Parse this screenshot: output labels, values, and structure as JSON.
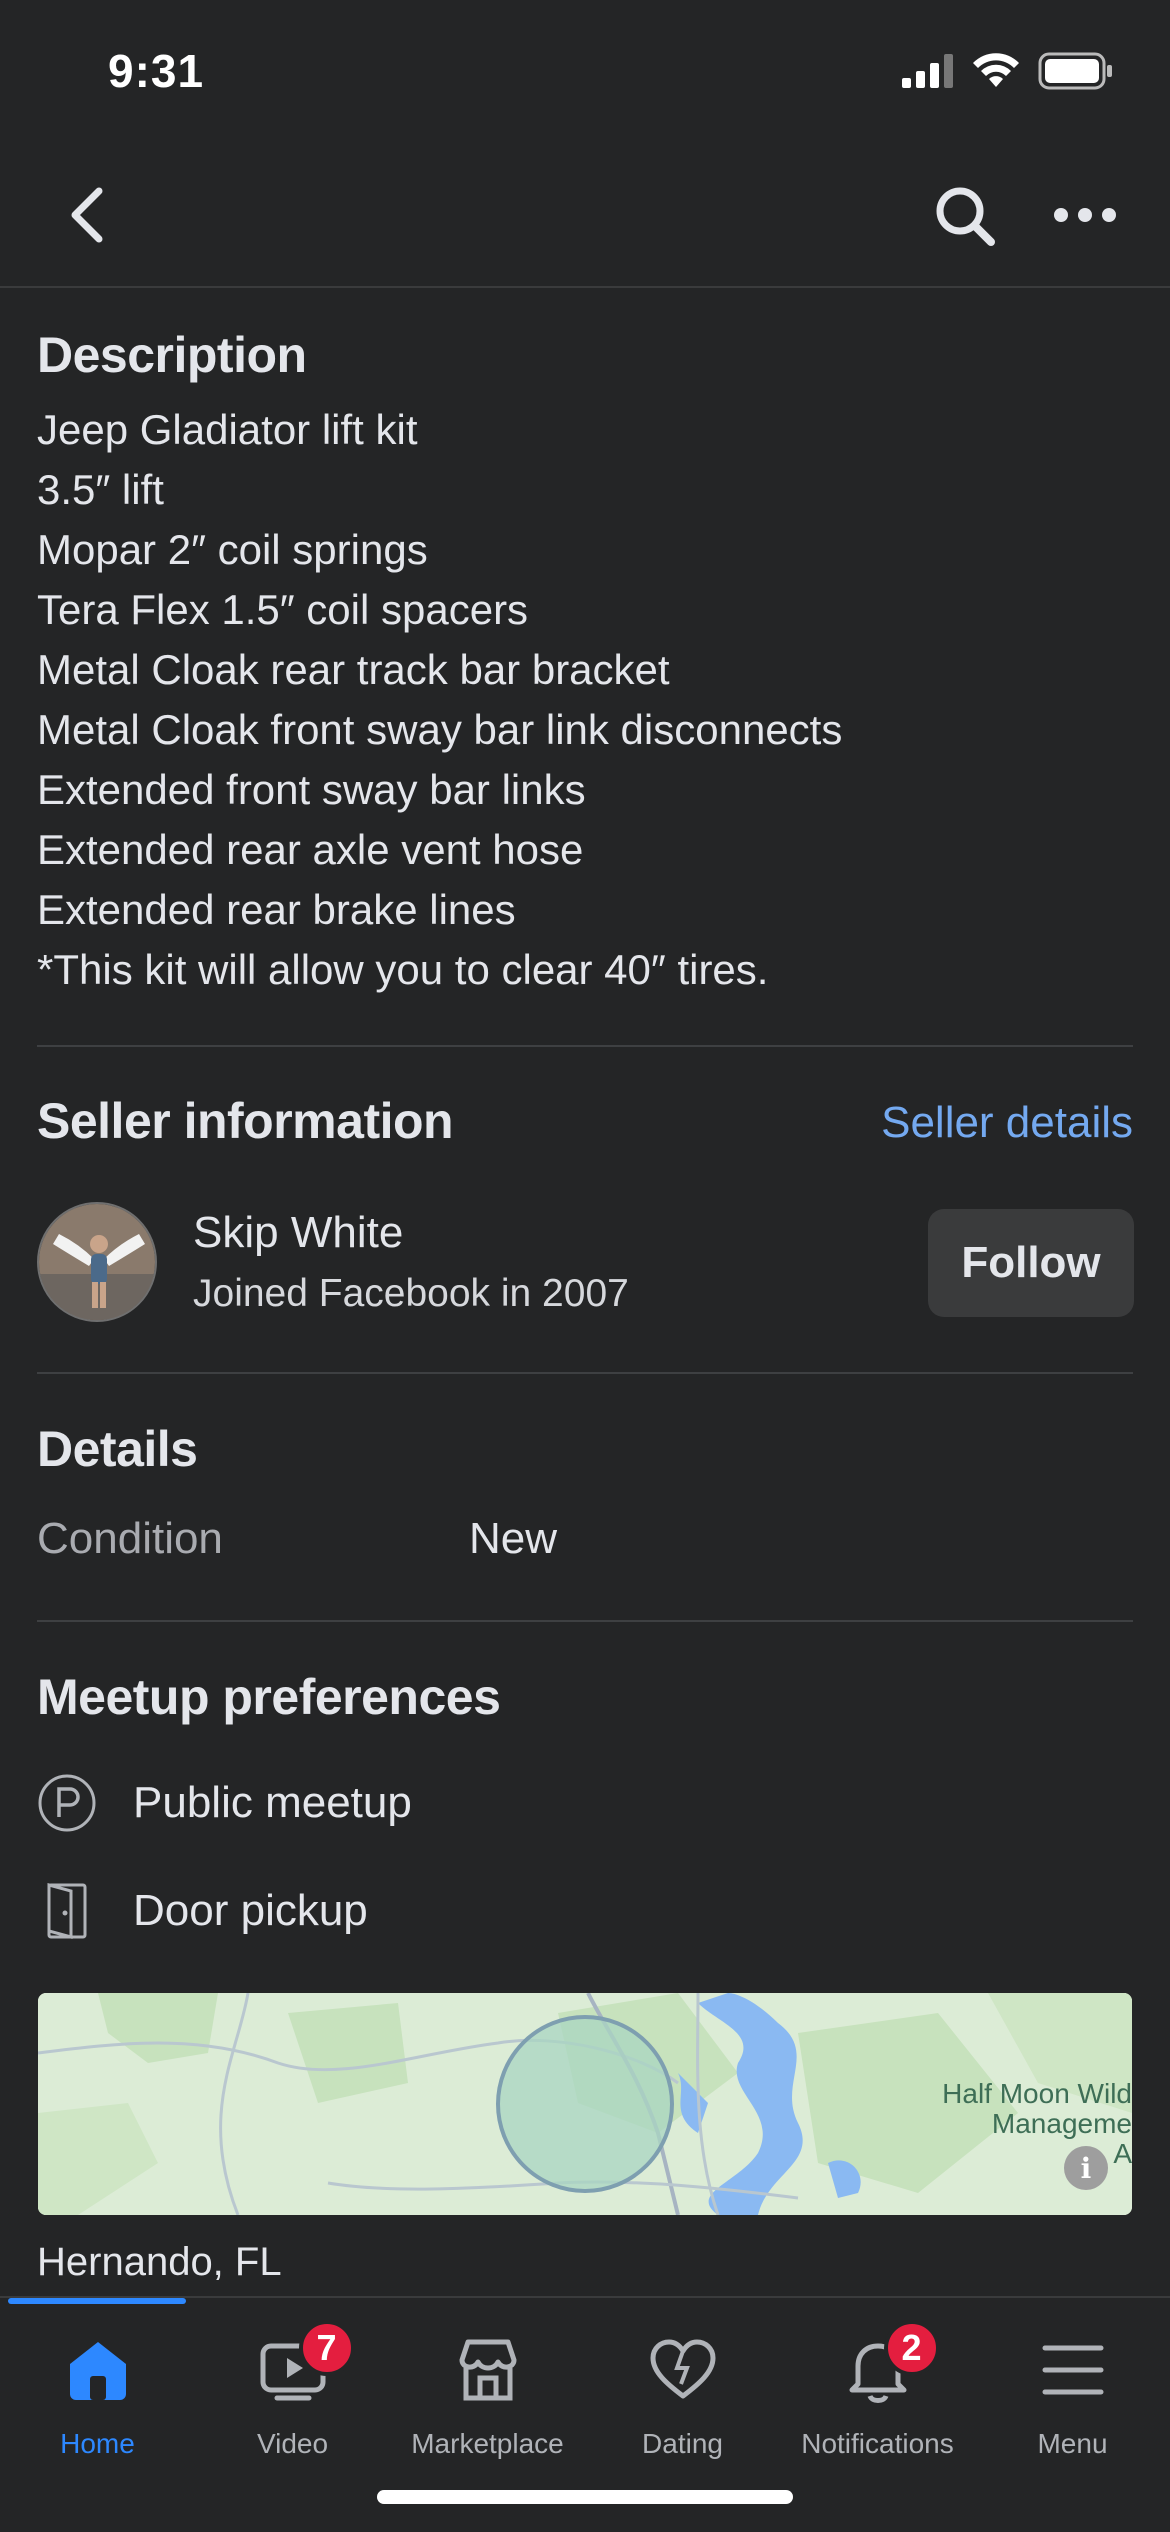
{
  "status": {
    "time": "9:31"
  },
  "description": {
    "title": "Description",
    "lines": [
      "Jeep Gladiator lift kit",
      "3.5″ lift",
      "Mopar 2″ coil springs",
      "Tera Flex 1.5″ coil spacers",
      "Metal Cloak rear track bar bracket",
      "Metal Cloak front sway bar link disconnects",
      "Extended front sway bar links",
      "Extended rear axle vent hose",
      "Extended rear brake lines",
      "*This kit will allow you to clear 40″ tires."
    ]
  },
  "seller": {
    "title": "Seller information",
    "details_link": "Seller details",
    "name": "Skip White",
    "joined": "Joined Facebook in 2007",
    "follow_label": "Follow"
  },
  "details": {
    "title": "Details",
    "condition_label": "Condition",
    "condition_value": "New"
  },
  "meetup": {
    "title": "Meetup preferences",
    "options": [
      {
        "label": "Public meetup",
        "icon": "parking-p-icon"
      },
      {
        "label": "Door pickup",
        "icon": "door-icon"
      }
    ]
  },
  "map": {
    "label_lines": [
      "Half Moon Wild",
      "Manageme",
      "A"
    ]
  },
  "location": "Hernando, FL",
  "tabs": [
    {
      "label": "Home",
      "icon": "home-icon",
      "active": true
    },
    {
      "label": "Video",
      "icon": "video-icon",
      "badge": "7"
    },
    {
      "label": "Marketplace",
      "icon": "marketplace-icon"
    },
    {
      "label": "Dating",
      "icon": "dating-icon"
    },
    {
      "label": "Notifications",
      "icon": "bell-icon",
      "badge": "2"
    },
    {
      "label": "Menu",
      "icon": "menu-icon"
    }
  ],
  "colors": {
    "background": "#242526",
    "accent": "#2d88ff",
    "link": "#74a9f0",
    "badge": "#e41e3f"
  }
}
